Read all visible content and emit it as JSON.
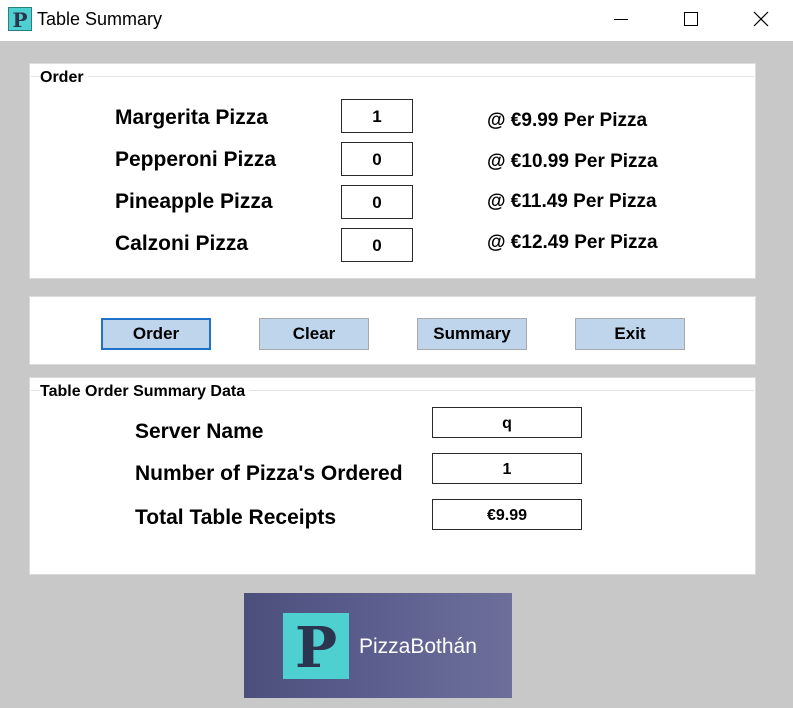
{
  "window": {
    "title": "Table Summary",
    "icon_letter": "P",
    "controls": [
      "minimize-icon",
      "maximize-icon",
      "close-icon"
    ]
  },
  "order": {
    "group_title": "Order",
    "items": [
      {
        "label": "Margerita Pizza",
        "qty": "1",
        "price": "@ €9.99 Per Pizza"
      },
      {
        "label": "Pepperoni Pizza",
        "qty": "0",
        "price": "@ €10.99 Per Pizza"
      },
      {
        "label": "Pineapple Pizza",
        "qty": "0",
        "price": "@ €11.49 Per Pizza"
      },
      {
        "label": "Calzoni Pizza",
        "qty": "0",
        "price": "@ €12.49 Per Pizza"
      }
    ]
  },
  "buttons": {
    "order": "Order",
    "clear": "Clear",
    "summary": "Summary",
    "exit": "Exit"
  },
  "summary": {
    "group_title": "Table Order Summary Data",
    "server_label": "Server Name",
    "server_value": "q",
    "count_label": "Number of Pizza's Ordered",
    "count_value": "1",
    "total_label": "Total Table Receipts",
    "total_value": "€9.99"
  },
  "logo": {
    "letter": "P",
    "text": "PizzaBothán"
  },
  "colors": {
    "accent": "#4ecfd0",
    "button_bg": "#bed5ec",
    "focus_border": "#1e73c8",
    "logo_bg": "#5e6190"
  }
}
